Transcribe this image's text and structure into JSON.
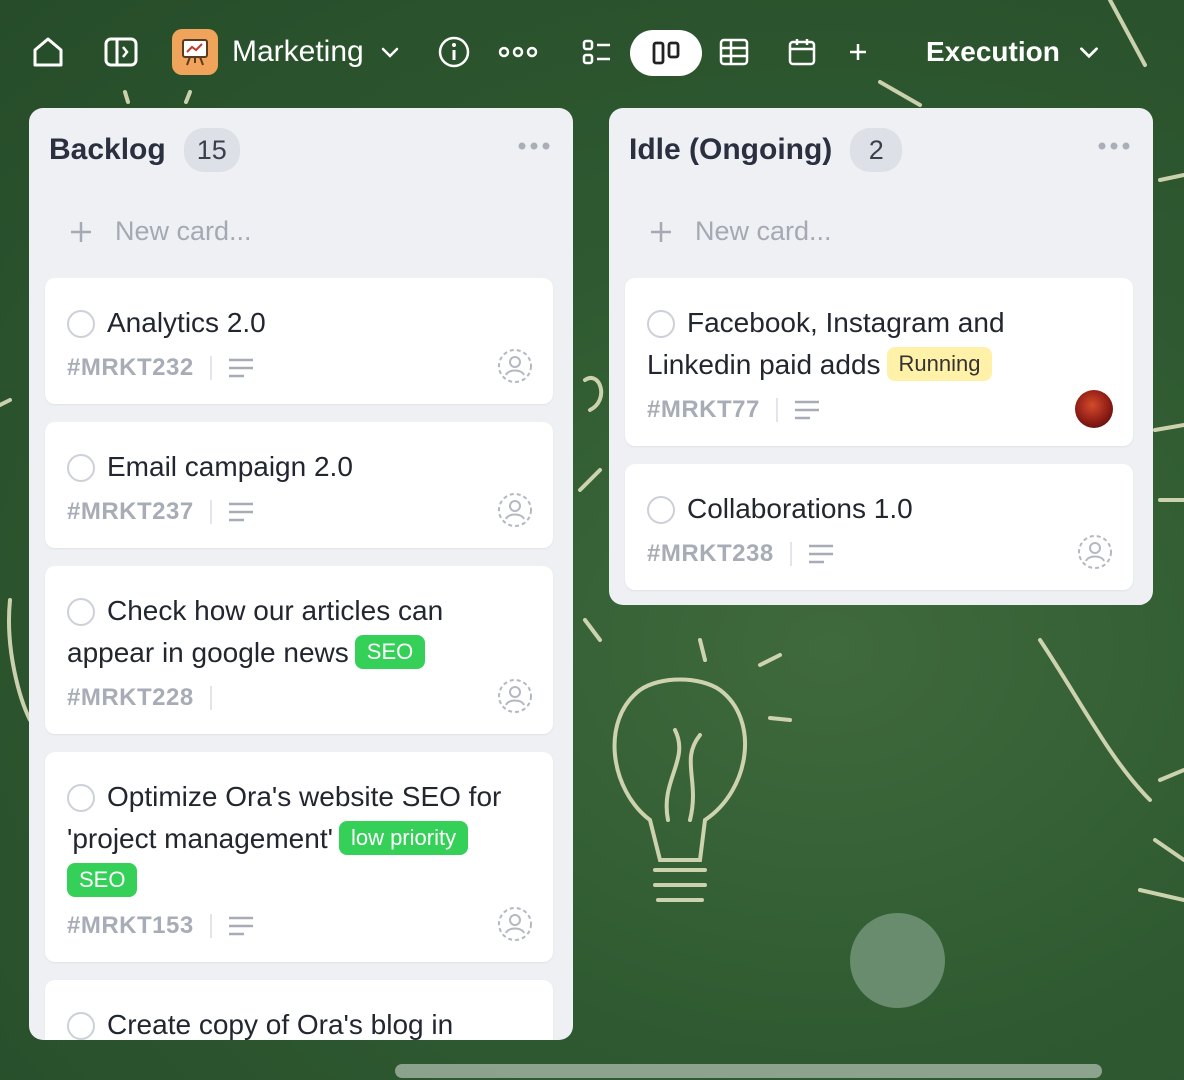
{
  "topbar": {
    "workspace_name": "Marketing",
    "view_name": "Execution"
  },
  "columns": [
    {
      "title": "Backlog",
      "count": "15",
      "new_card_placeholder": "New card...",
      "cards": [
        {
          "title": "Analytics 2.0",
          "id": "#MRKT232",
          "tags": []
        },
        {
          "title": "Email campaign 2.0",
          "id": "#MRKT237",
          "tags": []
        },
        {
          "title": "Check how our articles can appear in google news",
          "id": "#MRKT228",
          "tags": [
            "SEO"
          ]
        },
        {
          "title": "Optimize Ora's website SEO for 'project management'",
          "id": "#MRKT153",
          "tags": [
            "low priority",
            "SEO"
          ]
        },
        {
          "title": "Create copy of Ora's blog in",
          "id": "",
          "tags": []
        }
      ]
    },
    {
      "title": "Idle (Ongoing)",
      "count": "2",
      "new_card_placeholder": "New card...",
      "cards": [
        {
          "title": "Facebook, Instagram and Linkedin paid adds",
          "id": "#MRKT77",
          "tags": [
            "Running"
          ]
        },
        {
          "title": "Collaborations 1.0",
          "id": "#MRKT238",
          "tags": []
        }
      ]
    }
  ],
  "colors": {
    "background": "#2f5a31",
    "column": "#eef0f4",
    "tag_green": "#34d058",
    "tag_yellow": "#fff2a8",
    "workspace_logo": "#f0a35a"
  }
}
